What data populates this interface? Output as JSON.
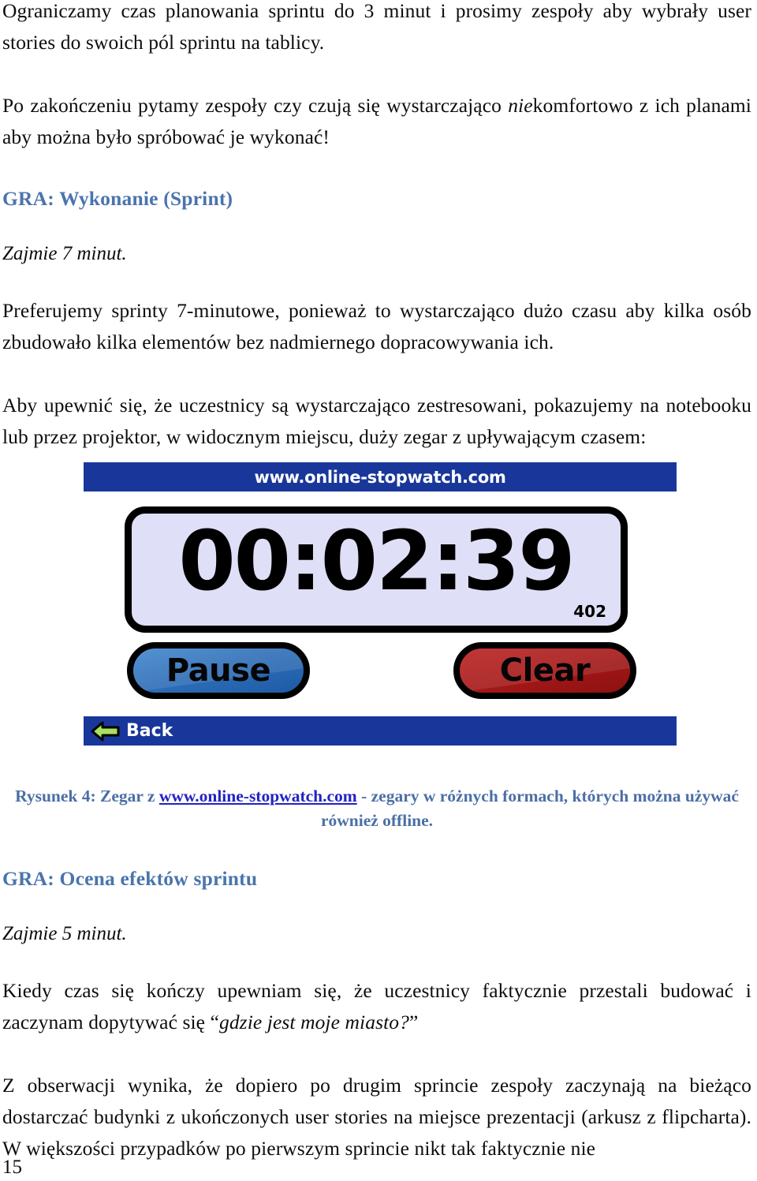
{
  "document": {
    "page_number": "15",
    "heading_color": "#4a74ad",
    "caption_color": "#4a6fa5",
    "link_color": "#2222c4"
  },
  "paragraphs": {
    "p1": "Ograniczamy czas planowania sprintu do 3 minut i prosimy zespoły aby wybrały user stories do swoich pól sprintu na tablicy.",
    "p2_a": "Po zakończeniu pytamy zespoły czy czują się wystarczająco ",
    "p2_em": "nie",
    "p2_b": "komfortowo z ich planami aby można było spróbować je wykonać!",
    "p3": "Preferujemy sprinty 7-minutowe, ponieważ to wystarczająco dużo czasu aby kilka osób zbudowało kilka elementów bez nadmiernego dopracowywania ich.",
    "p4": "Aby upewnić się, że uczestnicy są wystarczająco zestresowani, pokazujemy na notebooku lub przez projektor, w widocznym miejscu, duży zegar z upływającym czasem:",
    "p5_a": "Kiedy czas się kończy upewniam się, że uczestnicy faktycznie przestali budować i zaczynam dopytywać się “",
    "p5_em": "gdzie jest moje miasto?",
    "p5_b": "”",
    "p6": "Z obserwacji wynika, że dopiero po drugim sprincie zespoły zaczynają na bieżąco dostarczać budynki z ukończonych user stories na miejsce prezentacji (arkusz z flipcharta). W większości przypadków po pierwszym sprincie nikt tak faktycznie nie"
  },
  "sections": {
    "heading_1": "GRA: Wykonanie (Sprint)",
    "note_1": "Zajmie 7 minut.",
    "heading_2": "GRA: Ocena efektów sprintu",
    "note_2": "Zajmie 5 minut."
  },
  "figure": {
    "banner_text": "www.online-stopwatch.com",
    "time_display": "00:02:39",
    "counter": "402",
    "pause_label": "Pause",
    "clear_label": "Clear",
    "back_label": "Back",
    "banner_color": "#19379a",
    "display_bg": "#dfdff7",
    "pause_color": "#2f6fb8",
    "clear_color": "#a81818",
    "back_arrow_color": "#a8e060"
  },
  "caption": {
    "lead": "Rysunek 4: Zegar z ",
    "link": "www.online-stopwatch.com",
    "tail": " - zegary w różnych formach, których można używać również offline."
  }
}
